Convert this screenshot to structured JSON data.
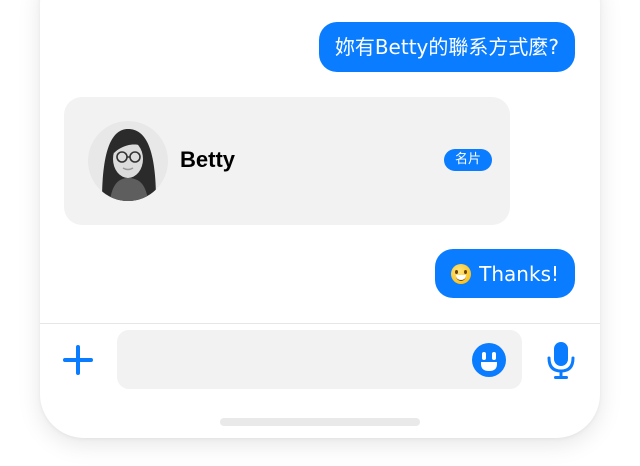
{
  "messages": {
    "outgoing_1": "妳有Betty的聯系方式麼?",
    "outgoing_2": "Thanks!"
  },
  "contact_card": {
    "name": "Betty",
    "badge": "名片"
  },
  "colors": {
    "accent": "#0a7cff",
    "bubble_gray": "#f2f2f2"
  },
  "icons": {
    "add": "plus-icon",
    "emoji": "emoji-icon",
    "mic": "microphone-icon",
    "message_emoji": "smiling-face-emoji"
  }
}
